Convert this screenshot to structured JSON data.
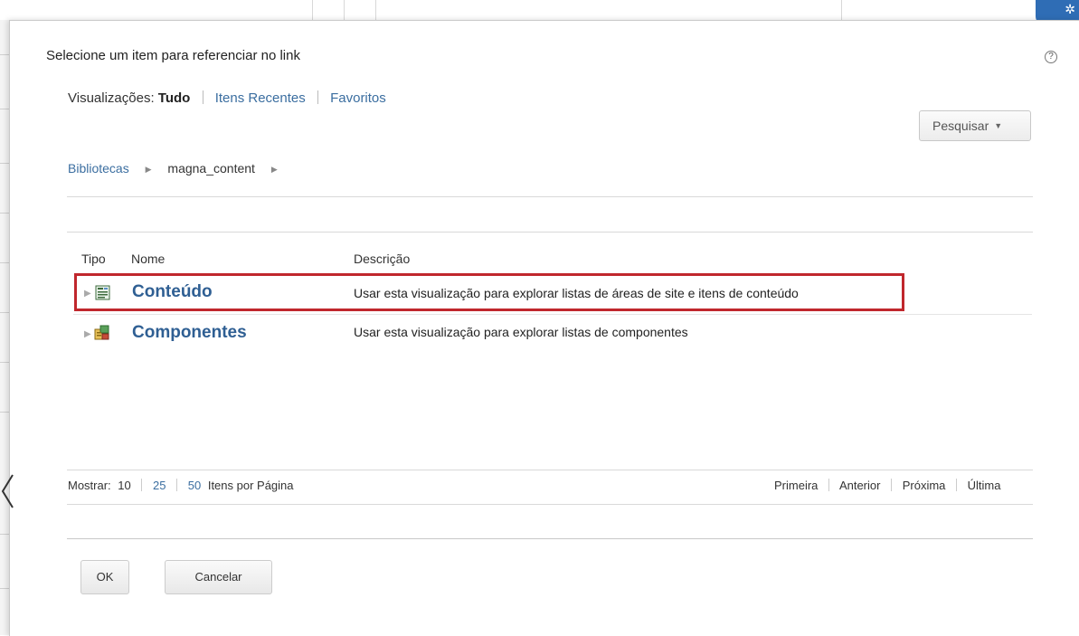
{
  "dialog": {
    "title": "Selecione um item para referenciar no link",
    "help_icon": "?"
  },
  "views": {
    "label": "Visualizações:",
    "current": "Tudo",
    "links": [
      "Itens Recentes",
      "Favoritos"
    ]
  },
  "search": {
    "label": "Pesquisar",
    "caret": "▼"
  },
  "breadcrumb": {
    "items": [
      "Bibliotecas",
      "magna_content"
    ],
    "separator": "▶"
  },
  "table": {
    "headers": [
      "Tipo",
      "Nome",
      "Descrição"
    ],
    "rows": [
      {
        "name": "Conteúdo",
        "description": "Usar esta visualização para explorar listas de áreas de site e itens de conteúdo",
        "icon": "content-icon"
      },
      {
        "name": "Componentes",
        "description": "Usar esta visualização para explorar listas de componentes",
        "icon": "components-icon"
      }
    ],
    "expander": "▶"
  },
  "pagination": {
    "show_label": "Mostrar:",
    "sizes": [
      "10",
      "25",
      "50"
    ],
    "per_page_label": "Itens por Página",
    "nav": [
      "Primeira",
      "Anterior",
      "Próxima",
      "Última"
    ]
  },
  "buttons": {
    "ok": "OK",
    "cancel": "Cancelar"
  },
  "colors": {
    "highlight": "#c0272d",
    "link": "#3b6ea0",
    "row_title": "#2f5f93"
  }
}
